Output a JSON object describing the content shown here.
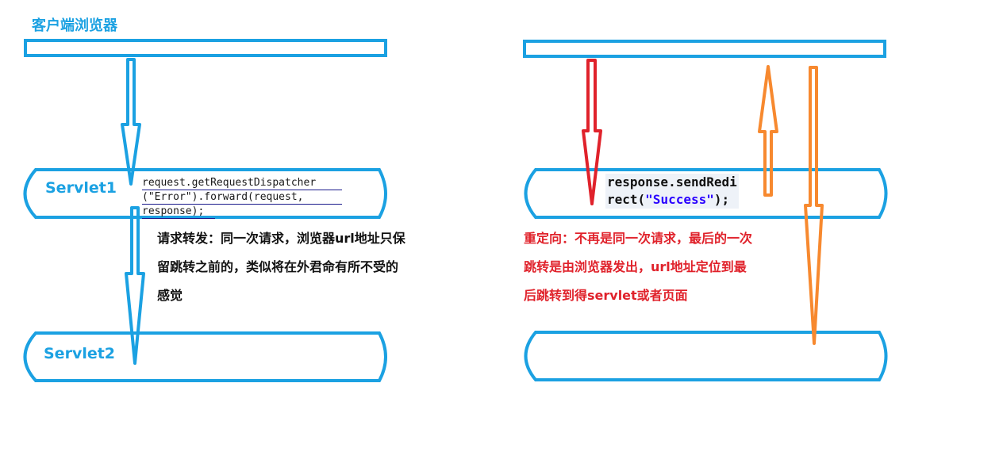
{
  "title": "客户端浏览器",
  "left": {
    "servlet1": "Servlet1",
    "servlet2": "Servlet2",
    "code_lines": [
      "request.getRequestDispatcher",
      "(\"Error\").forward(request,",
      "response);"
    ],
    "note_lines": [
      "请求转发：同一次请求，浏览器url地址只保",
      "留跳转之前的，类似将在外君命有所不受的",
      "感觉"
    ]
  },
  "right": {
    "code_line1": "response.sendRedi",
    "code_line2_prefix": "rect(",
    "code_line2_string": "\"Success\"",
    "code_line2_suffix": ");",
    "note_lines": [
      "重定向：不再是同一次请求，最后的一次",
      "跳转是由浏览器发出，url地址定位到最",
      "后跳转到得servlet或者页面"
    ]
  },
  "colors": {
    "blue": "#1ba1e2",
    "red": "#e0222b",
    "orange": "#f7892f",
    "text_black": "#111111",
    "string_blue": "#2a00ff"
  }
}
